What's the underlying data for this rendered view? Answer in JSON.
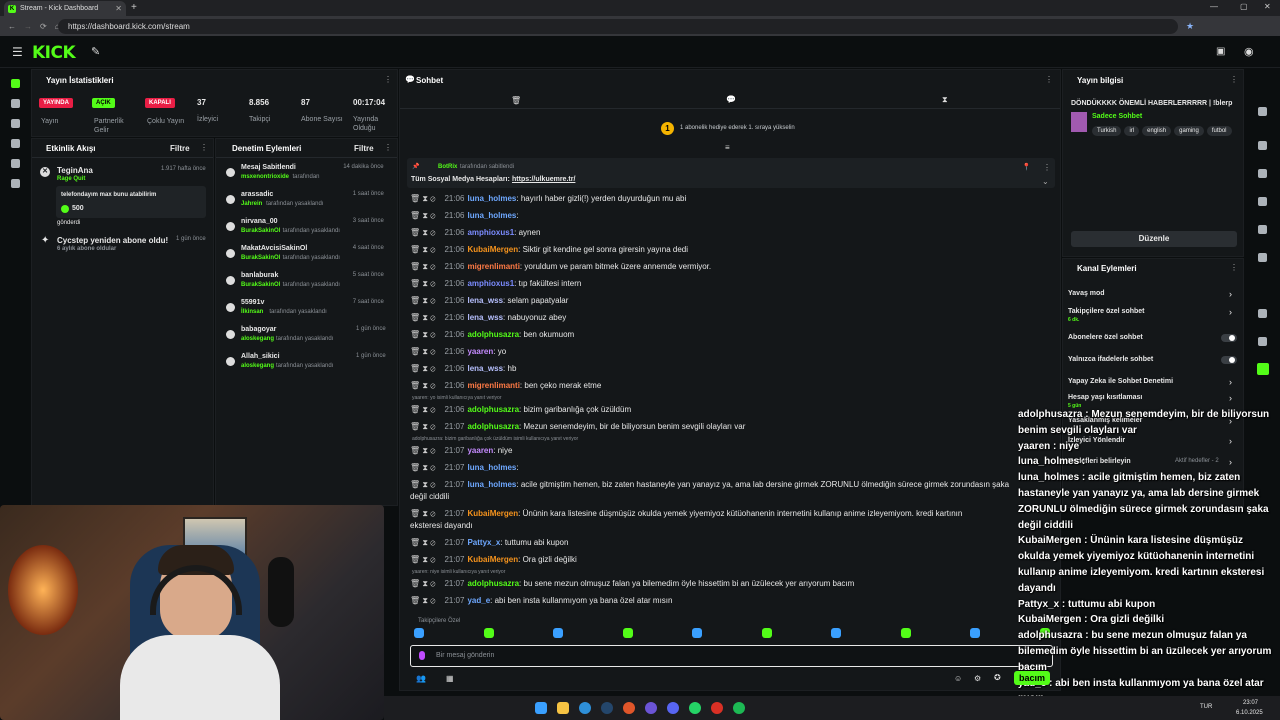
{
  "browser": {
    "tab_title": "Stream - Kick Dashboard",
    "url": "https://dashboard.kick.com/stream"
  },
  "app": {
    "logo": "KICK"
  },
  "stats": {
    "title": "Yayın İstatistikleri",
    "badges": [
      {
        "label": "YAYINDA",
        "caption": "Yayın",
        "color": "#e91e45"
      },
      {
        "label": "AÇIK",
        "caption": "Partnerlik Gelir",
        "color": "#53fc18"
      },
      {
        "label": "KAPALI",
        "caption": "Çoklu Yayın",
        "color": "#e91e45"
      }
    ],
    "numbers": [
      {
        "value": "37",
        "label": "İzleyici"
      },
      {
        "value": "8.856",
        "label": "Takipçi"
      },
      {
        "value": "87",
        "label": "Abone Sayısı"
      },
      {
        "value": "00:17:04",
        "label": "Yayında Olduğu"
      }
    ]
  },
  "activity": {
    "title": "Etkinlik Akışı",
    "filter": "Filtre",
    "items": [
      {
        "name": "TeginAna",
        "sub": "Rage Quit",
        "time": "1.917 hafta önce",
        "msg": "telefondayım max bunu atabilirim",
        "amount": "500",
        "sent": "gönderdi"
      },
      {
        "name": "Cycstep yeniden abone oldu!",
        "sub": "6 aylık abone oldular",
        "time": "1 gün önce"
      }
    ]
  },
  "moderation": {
    "title": "Denetim Eylemleri",
    "filter": "Filtre",
    "items": [
      {
        "title": "Mesaj Sabitlendi",
        "by": "msxenontrioxide",
        "suffix": "tarafından",
        "time": "14 dakika önce"
      },
      {
        "title": "arassadic",
        "by": "Jahrein",
        "suffix": "tarafından yasaklandı",
        "time": "1 saat önce"
      },
      {
        "title": "nirvana_00",
        "by": "BurakSakinOl",
        "suffix": "tarafından yasaklandı",
        "time": "3 saat önce"
      },
      {
        "title": "MakatAvcisiSakinOl",
        "by": "BurakSakinOl",
        "suffix": "tarafından yasaklandı",
        "time": "4 saat önce"
      },
      {
        "title": "banlaburak",
        "by": "BurakSakinOl",
        "suffix": "tarafından yasaklandı",
        "time": "5 saat önce"
      },
      {
        "title": "55991v",
        "by": "İlkinsan",
        "suffix": "tarafından yasaklandı",
        "time": "7 saat önce"
      },
      {
        "title": "babagoyar",
        "by": "aloskegang",
        "suffix": "tarafından yasaklandı",
        "time": "1 gün önce"
      },
      {
        "title": "Allah_sikici",
        "by": "aloskegang",
        "suffix": "tarafından yasaklandı",
        "time": "1 gün önce"
      }
    ]
  },
  "chat": {
    "title": "Sohbet",
    "sub_goal": "1 abonelik hediye ederek 1. sıraya yükselin",
    "sub_goal_count": "1",
    "pinned_by": "BotRix",
    "pinned_suffix": "tarafından sabitlendi",
    "pinned_text": "Tüm Sosyal Medya Hesapları:",
    "pinned_link": "https://ulkuemre.tr/",
    "messages": [
      {
        "time": "21:06",
        "user": "luna_holmes",
        "color": "#6ea8ff",
        "text": ": hayırlı haber gizli(!) yerden duyurduğun mu abi"
      },
      {
        "time": "21:06",
        "user": "luna_holmes",
        "color": "#6ea8ff",
        "text": ": "
      },
      {
        "time": "21:06",
        "user": "amphioxus1",
        "color": "#7b8cff",
        "text": ": aynen"
      },
      {
        "time": "21:06",
        "user": "KubaiMergen",
        "color": "#f7941d",
        "text": ": Siktir git kendine gel sonra girersin yayına dedi"
      },
      {
        "time": "21:06",
        "user": "migrenlimanti",
        "color": "#ff7a45",
        "text": ": yoruldum ve param bitmek üzere annemde vermiyor."
      },
      {
        "time": "21:06",
        "user": "amphioxus1",
        "color": "#7b8cff",
        "text": ": tıp fakültesi intern"
      },
      {
        "time": "21:06",
        "user": "lena_wss",
        "color": "#b7c0ff",
        "text": ": selam papatyalar"
      },
      {
        "time": "21:06",
        "user": "lena_wss",
        "color": "#b7c0ff",
        "text": ": nabuyonuz abey"
      },
      {
        "time": "21:06",
        "user": "adolphusazra",
        "color": "#53fc18",
        "text": ": ben okumuom"
      },
      {
        "time": "21:06",
        "user": "yaaren",
        "color": "#c58bff",
        "text": ": yo"
      },
      {
        "time": "21:06",
        "user": "lena_wss",
        "color": "#b7c0ff",
        "text": ": hb"
      },
      {
        "time": "21:06",
        "user": "migrenlimanti",
        "color": "#ff7a45",
        "text": ": ben çeko merak etme"
      },
      {
        "time": "21:06",
        "user": "adolphusazra",
        "color": "#53fc18",
        "text": ": bizim garibanlığa çok üzüldüm",
        "reply": "yaaren: yo isimli kullanıcıya yanıt veriyor"
      },
      {
        "time": "21:07",
        "user": "adolphusazra",
        "color": "#53fc18",
        "text": ": Mezun senemdeyim, bir de biliyorsun benim sevgili olayları var"
      },
      {
        "time": "21:07",
        "user": "yaaren",
        "color": "#c58bff",
        "text": ": niye",
        "reply": "adolphusazra: bizim garibanlığa çok üzüldüm isimli kullanıcıya yanıt veriyor"
      },
      {
        "time": "21:07",
        "user": "luna_holmes",
        "color": "#6ea8ff",
        "text": ": "
      },
      {
        "time": "21:07",
        "user": "luna_holmes",
        "color": "#6ea8ff",
        "text": ": acile gitmiştim hemen, biz zaten hastaneyle yan yanayız ya, ama lab dersine girmek ZORUNLU ölmediğin sürece girmek zorundasın şaka",
        "cont": "değil ciddili"
      },
      {
        "time": "21:07",
        "user": "KubaiMergen",
        "color": "#f7941d",
        "text": ": Ününin kara listesine düşmüşüz okulda yemek yiyemiyoz kütüohanenin internetini kullanıp anime izleyemiyom. kredi kartının",
        "cont": "eksteresi dayandı"
      },
      {
        "time": "21:07",
        "user": "Pattyx_x",
        "color": "#6ea8ff",
        "text": ": tuttumu abi kupon"
      },
      {
        "time": "21:07",
        "user": "KubaiMergen",
        "color": "#f7941d",
        "text": ": Ora gizli değilki"
      },
      {
        "time": "21:07",
        "user": "adolphusazra",
        "color": "#53fc18",
        "text": ": bu sene mezun olmuşuz falan ya bilemedim öyle hissettim bi an üzülecek yer arıyorum bacım",
        "reply": "yaaren: niye isimli kullanıcıya yanıt veriyor"
      },
      {
        "time": "21:07",
        "user": "yad_e",
        "color": "#6ea8ff",
        "text": ": abi ben insta kullanmıyom ya bana özel atar mısın"
      }
    ],
    "followers_label": "Takipçilere Özel",
    "input_placeholder": "Bir mesaj gönderin",
    "send_label": "bacım"
  },
  "stream_info": {
    "title": "Yayın bilgisi",
    "headline": "DÖNDÜKKKK ÖNEMLİ HABERLERRRRR | !blerp",
    "category": "Sadece Sohbet",
    "tags": [
      "Turkish",
      "irl",
      "english",
      "gaming",
      "futbol"
    ],
    "edit_button": "Düzenle"
  },
  "channel_actions": {
    "title": "Kanal Eylemleri",
    "items": [
      {
        "label": "Yavaş mod"
      },
      {
        "label": "Takipçilere özel sohbet",
        "sub": "6 dk."
      },
      {
        "label": "Abonelere özel sohbet"
      },
      {
        "label": "Yalnızca ifadelerle sohbet"
      },
      {
        "label": "Yapay Zeka ile Sohbet Denetimi"
      },
      {
        "label": "Hesap yaşı kısıtlaması",
        "sub": "5 gün"
      },
      {
        "label": "Yasaklanmış kelimeler"
      },
      {
        "label": "İzleyici Yönlendir"
      },
      {
        "label": "Hedefleri belirleyin",
        "extra": "Aktif hedefler - 2"
      }
    ]
  },
  "overlay": {
    "lines": [
      {
        "text": "adolphusazra : Mezun senemdeyim, bir de biliyorsun",
        "color": "#53fc18",
        "user": "adolphusazra"
      },
      {
        "text": "benim sevgili olayları var"
      },
      {
        "text": "yaaren : niye",
        "user": "yaaren",
        "color": "#c58bff"
      },
      {
        "text": "luna_holmes :",
        "user": "luna_holmes",
        "color": "#6ea8ff"
      },
      {
        "text": "luna_holmes : acile gitmiştim hemen, biz zaten",
        "user": "luna_holmes",
        "color": "#6ea8ff"
      },
      {
        "text": "hastaneyle yan yanayız ya, ama lab dersine girmek"
      },
      {
        "text": "ZORUNLU ölmediğin sürece girmek zorundasın şaka"
      },
      {
        "text": "değil ciddili"
      },
      {
        "text": "KubaiMergen : Ününin kara listesine düşmüşüz",
        "user": "KubaiMergen",
        "color": "#f7941d"
      },
      {
        "text": "okulda yemek yiyemiyoz kütüohanenin internetini"
      },
      {
        "text": "kullanıp anime izleyemiyom. kredi kartının eksteresi"
      },
      {
        "text": "dayandı"
      },
      {
        "text": "Pattyx_x : tuttumu abi kupon",
        "user": "Pattyx_x",
        "color": "#6ea8ff"
      },
      {
        "text": "KubaiMergen : Ora gizli değilki",
        "user": "KubaiMergen",
        "color": "#f7941d"
      },
      {
        "text": "adolphusazra : bu sene mezun olmuşuz falan ya",
        "user": "adolphusazra",
        "color": "#53fc18"
      },
      {
        "text": "bilemedim öyle hissettim bi an üzülecek yer arıyorum"
      },
      {
        "text": "bacım"
      },
      {
        "text": "yad_e : abi ben insta kullanmıyom ya bana özel atar",
        "user": "yad_e",
        "color": "#6ea8ff"
      },
      {
        "text": "mısın"
      }
    ]
  },
  "taskbar": {
    "time": "23:07",
    "date": "6.10.2025",
    "lang": "TUR"
  }
}
